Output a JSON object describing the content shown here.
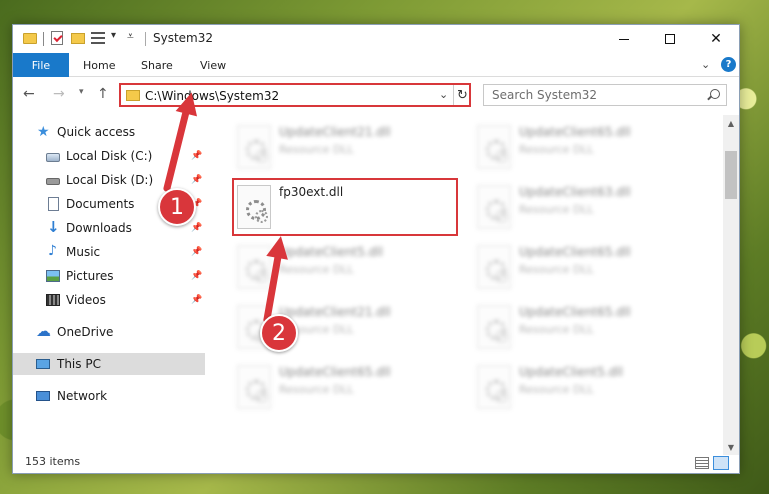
{
  "window": {
    "title": "System32"
  },
  "ribbon": {
    "file": "File",
    "home": "Home",
    "share": "Share",
    "view": "View",
    "help": "?"
  },
  "address": {
    "path": "C:\\Windows\\System32",
    "search_placeholder": "Search System32"
  },
  "sidebar": {
    "items": [
      {
        "label": "Quick access"
      },
      {
        "label": "Local Disk (C:)"
      },
      {
        "label": "Local Disk (D:)"
      },
      {
        "label": "Documents"
      },
      {
        "label": "Downloads"
      },
      {
        "label": "Music"
      },
      {
        "label": "Pictures"
      },
      {
        "label": "Videos"
      },
      {
        "label": "OneDrive"
      },
      {
        "label": "This PC"
      },
      {
        "label": "Network"
      }
    ]
  },
  "files": [
    {
      "name": "UpdateClient21.dll",
      "type": "Resource DLL"
    },
    {
      "name": "UpdateClient65.dll",
      "type": "Resource DLL"
    },
    {
      "name": "fp30ext.dll",
      "type": ""
    },
    {
      "name": "UpdateClient63.dll",
      "type": "Resource DLL"
    },
    {
      "name": "UpdateClient5.dll",
      "type": "Resource DLL"
    },
    {
      "name": "UpdateClient65.dll",
      "type": "Resource DLL"
    },
    {
      "name": "UpdateClient21.dll",
      "type": "Resource DLL"
    },
    {
      "name": "UpdateClient65.dll",
      "type": "Resource DLL"
    },
    {
      "name": "UpdateClient65.dll",
      "type": "Resource DLL"
    },
    {
      "name": "UpdateClient5.dll",
      "type": "Resource DLL"
    }
  ],
  "status": {
    "count": "153 items"
  },
  "annotations": {
    "step1": "1",
    "step2": "2"
  },
  "colors": {
    "accent": "#1979ca",
    "annotation": "#d9363b"
  }
}
